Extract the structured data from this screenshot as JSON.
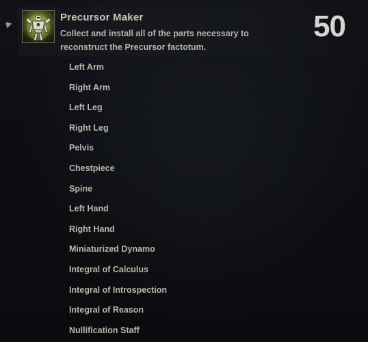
{
  "achievement": {
    "title": "Precursor Maker",
    "description": "Collect and install all of the parts necessary to reconstruct the Precursor factotum.",
    "points": "50",
    "icon": "factotum-icon",
    "collapse_icon": "triangle-collapse-icon"
  },
  "criteria": [
    "Left Arm",
    "Right Arm",
    "Left Leg",
    "Right Leg",
    "Pelvis",
    "Chestpiece",
    "Spine",
    "Left Hand",
    "Right Hand",
    "Miniaturized Dynamo",
    "Integral of Calculus",
    "Integral of Introspection",
    "Integral of Reason",
    "Nullification Staff"
  ],
  "colors": {
    "background": "#0b0d11",
    "title_text": "#c8c6b4",
    "body_text": "#bab8a6",
    "points_text": "#d6d6d0",
    "icon_accent": "#b7c84a"
  }
}
